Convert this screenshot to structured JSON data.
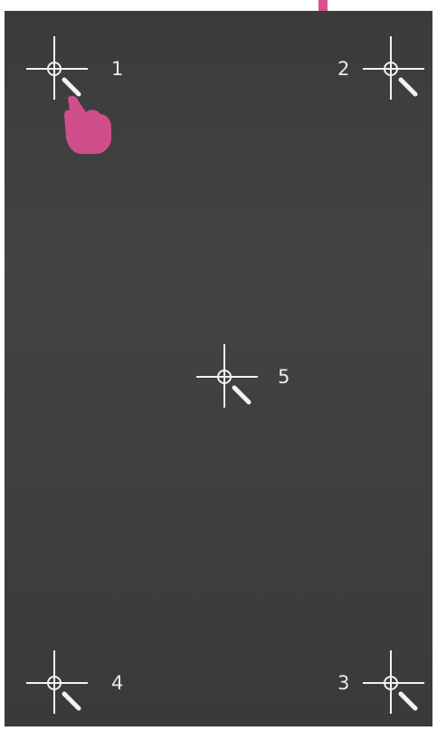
{
  "calibration": {
    "points": [
      {
        "id": "1",
        "label": "1",
        "icon": "crosshair-stylus-icon"
      },
      {
        "id": "2",
        "label": "2",
        "icon": "crosshair-stylus-icon"
      },
      {
        "id": "3",
        "label": "3",
        "icon": "crosshair-stylus-icon"
      },
      {
        "id": "4",
        "label": "4",
        "icon": "crosshair-stylus-icon"
      },
      {
        "id": "5",
        "label": "5",
        "icon": "crosshair-stylus-icon"
      }
    ],
    "active_point": "1",
    "indicators": {
      "hand": "pointing-hand-icon",
      "arrow": "down-arrow-icon"
    }
  },
  "colors": {
    "background": "#3f3f41",
    "crosshair": "#f2f2f2",
    "label": "#eaeaea",
    "accent": "#d8508f"
  }
}
